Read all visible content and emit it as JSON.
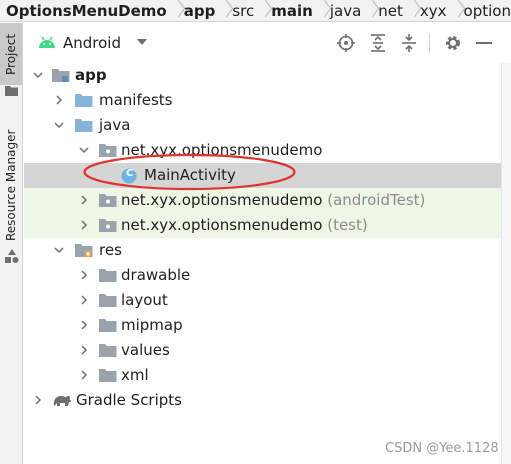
{
  "breadcrumb": [
    "OptionsMenuDemo",
    "app",
    "src",
    "main",
    "java",
    "net",
    "xyx",
    "option"
  ],
  "side_tabs": {
    "project": "Project",
    "resource_manager": "Resource Manager"
  },
  "panel": {
    "title": "Android"
  },
  "tree": {
    "app": "app",
    "manifests": "manifests",
    "java": "java",
    "package_main": "net.xyx.optionsmenudemo",
    "main_activity": "MainActivity",
    "class_badge": "C",
    "package_android_test": "net.xyx.optionsmenudemo",
    "android_test_suffix": "(androidTest)",
    "package_test": "net.xyx.optionsmenudemo",
    "test_suffix": "(test)",
    "res": "res",
    "drawable": "drawable",
    "layout": "layout",
    "mipmap": "mipmap",
    "values": "values",
    "xml": "xml",
    "gradle_scripts": "Gradle Scripts"
  },
  "watermark": "CSDN @Yee.1128",
  "colors": {
    "folder_blue": "#87b4d6",
    "package_gray": "#9aa3ab",
    "android_green": "#3ddc84",
    "selection": "#d5d5d5",
    "test_bg": "#eef6e6",
    "highlight_red": "#e0332d"
  }
}
